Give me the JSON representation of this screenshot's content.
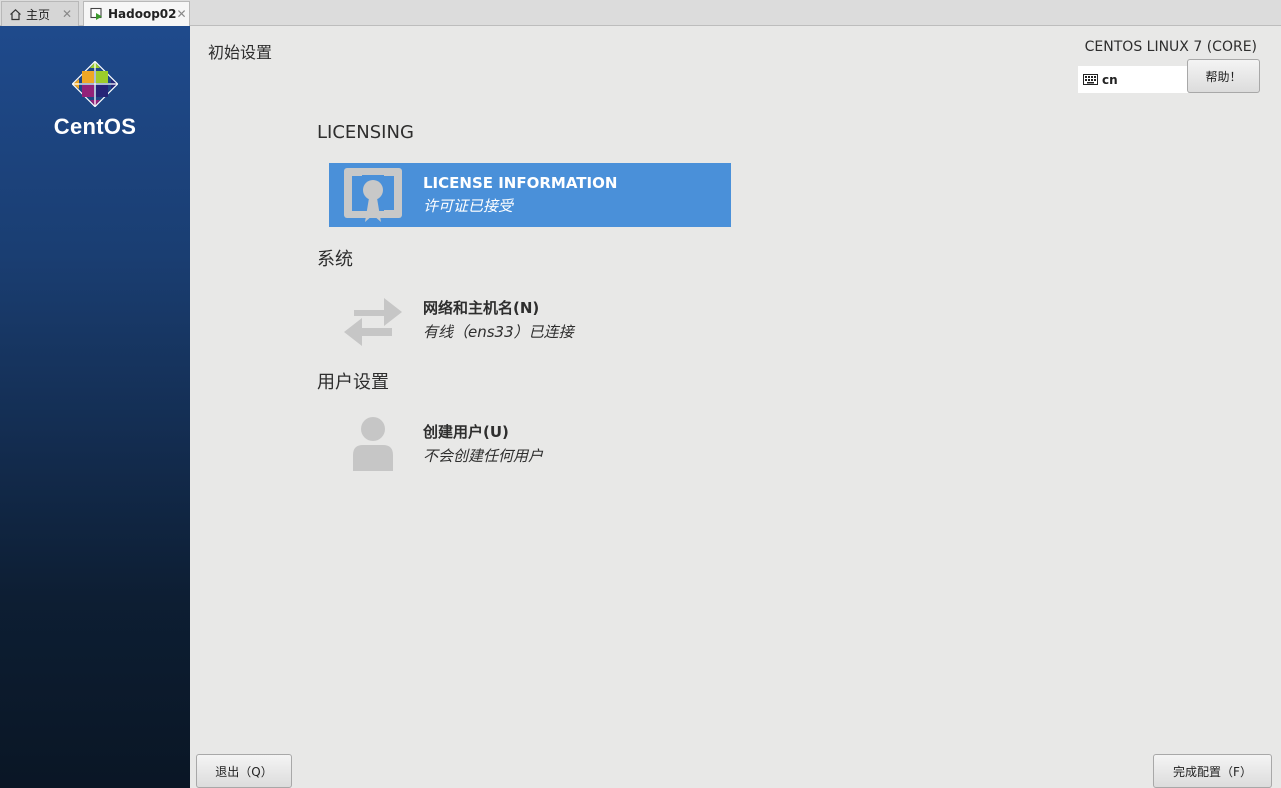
{
  "tabs": [
    {
      "label": "主页",
      "icon": "home-icon"
    },
    {
      "label": "Hadoop02",
      "icon": "vm-icon"
    }
  ],
  "tab_close": "✕",
  "sidebar": {
    "brand": "CentOS"
  },
  "header": {
    "title": "初始设置",
    "distro": "CENTOS LINUX 7 (CORE)",
    "keyboard_layout": "cn",
    "help_label": "帮助！"
  },
  "sections": {
    "licensing": {
      "title": "LICENSING",
      "spoke": {
        "name": "LICENSE INFORMATION",
        "status": "许可证已接受",
        "icon": "license-certificate-icon"
      }
    },
    "system": {
      "title": "系统",
      "spoke": {
        "name": "网络和主机名(N)",
        "status": "有线（ens33）已连接",
        "icon": "network-arrows-icon"
      }
    },
    "user": {
      "title": "用户设置",
      "spoke": {
        "name": "创建用户(U)",
        "status": "不会创建任何用户",
        "icon": "user-icon"
      }
    }
  },
  "footer": {
    "quit_label": "退出（Q）",
    "done_label": "完成配置（F）"
  },
  "colors": {
    "selected_spoke": "#4a90d9",
    "background": "#e8e8e7",
    "sidebar_top": "#1f4a8c",
    "sidebar_bottom": "#0a1625"
  }
}
